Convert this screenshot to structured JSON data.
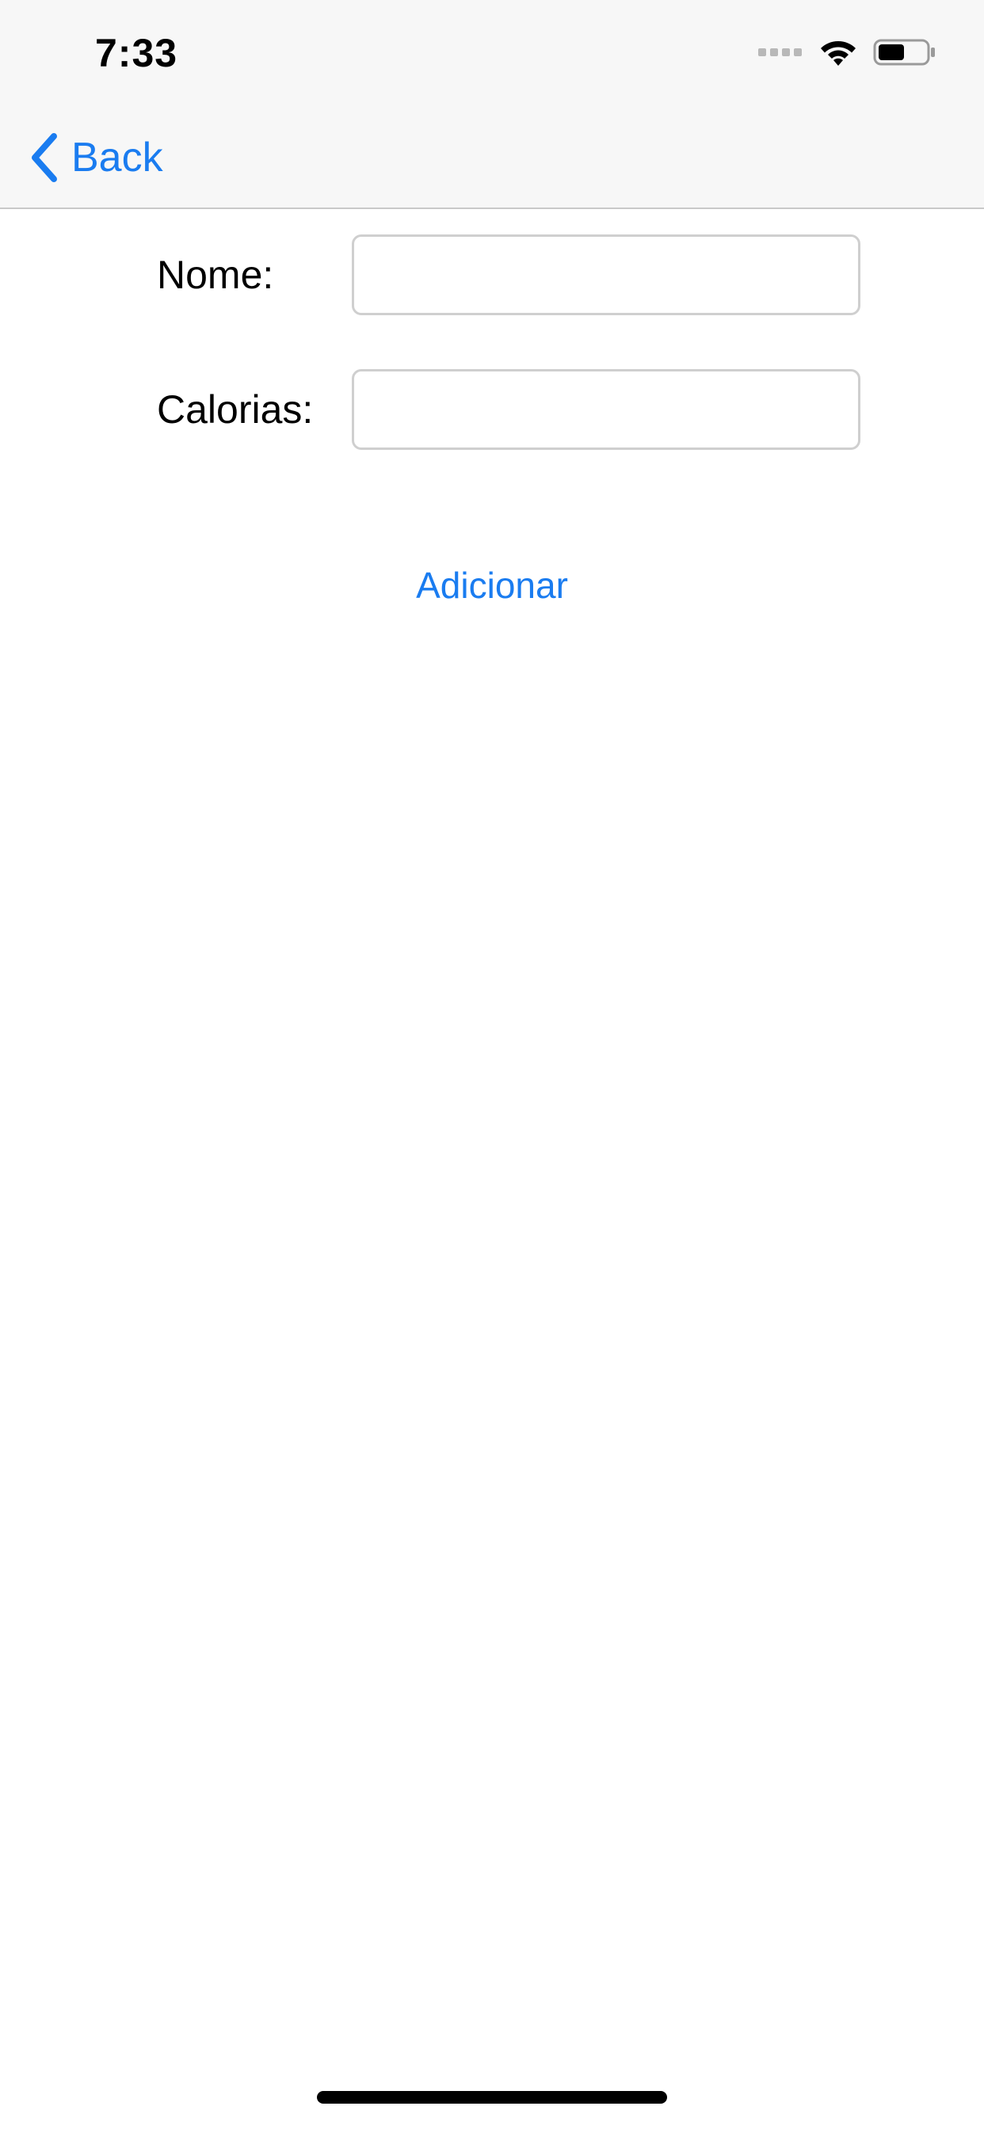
{
  "status_bar": {
    "time": "7:33",
    "icons": [
      "cellular-signal-icon",
      "wifi-icon",
      "battery-icon"
    ]
  },
  "nav_bar": {
    "back_label": "Back",
    "back_icon": "chevron-left-icon"
  },
  "form": {
    "fields": [
      {
        "label": "Nome:",
        "value": "",
        "placeholder": ""
      },
      {
        "label": "Calorias:",
        "value": "",
        "placeholder": ""
      }
    ],
    "submit_label": "Adicionar"
  },
  "colors": {
    "accent": "#1a7cf0",
    "bar_background": "#f7f7f7",
    "input_border": "#cfcfcf"
  }
}
